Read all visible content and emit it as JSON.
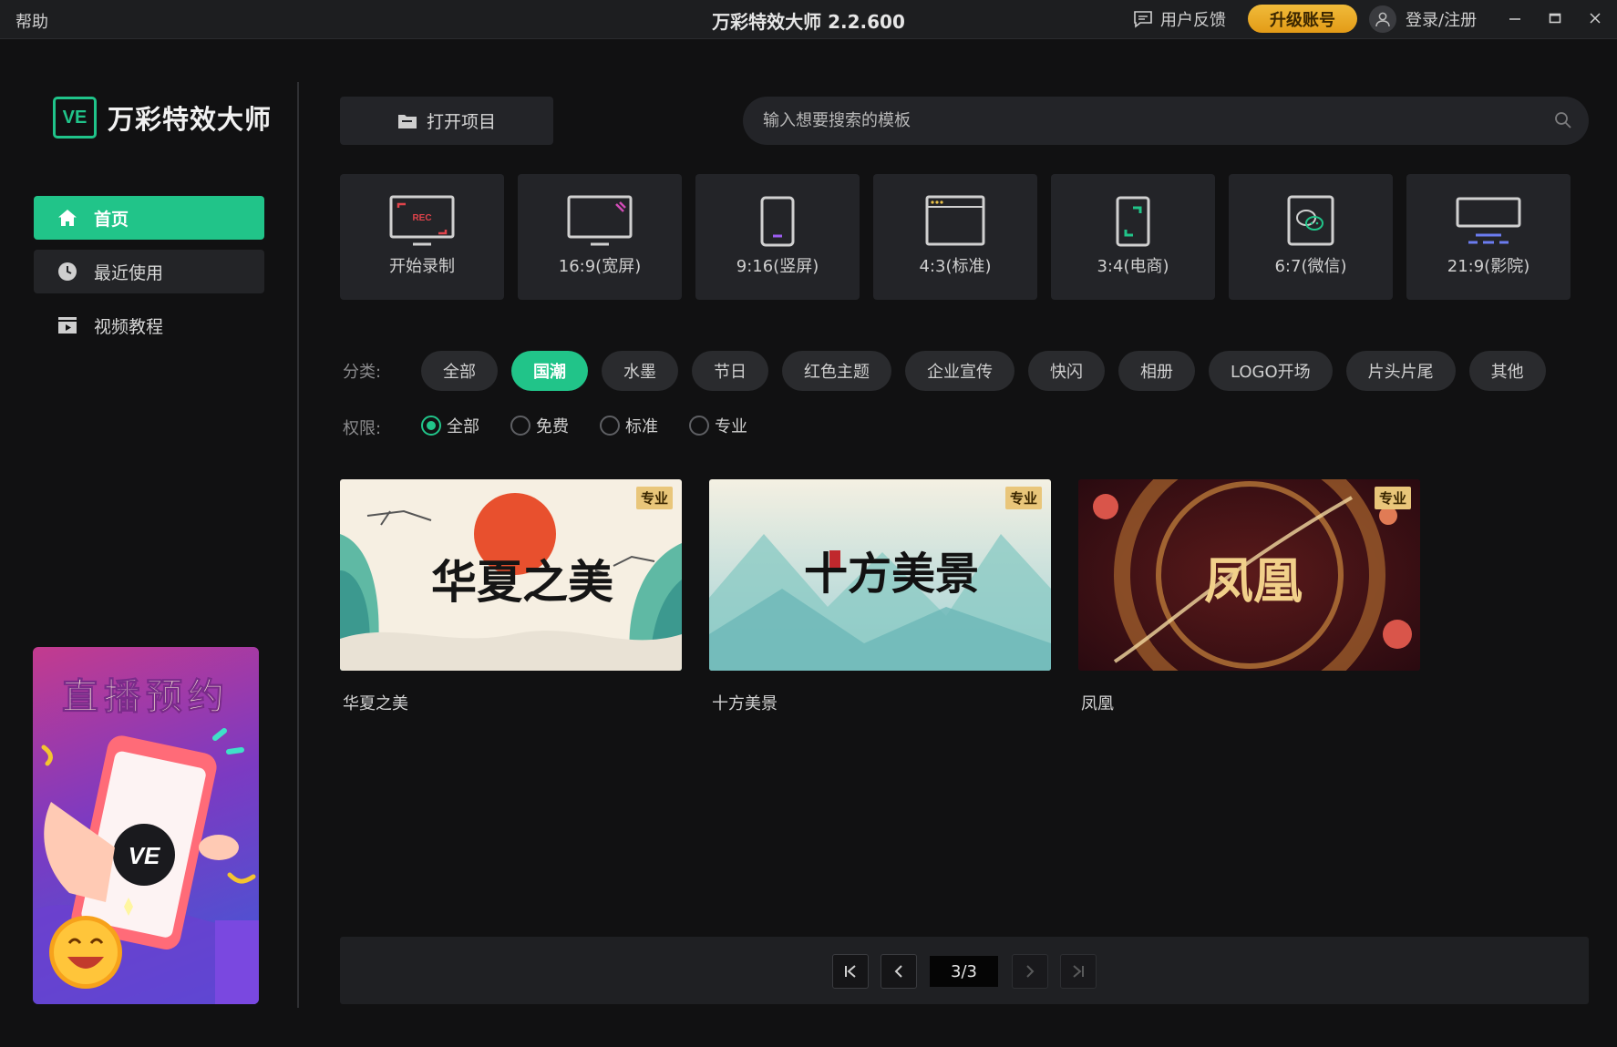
{
  "titlebar": {
    "help": "帮助",
    "title": "万彩特效大师 2.2.600",
    "feedback": "用户反馈",
    "upgrade": "升级账号",
    "login": "登录/注册"
  },
  "sidebar": {
    "logo_mark": "VE",
    "logo_text": "万彩特效大师",
    "items": [
      {
        "label": "首页",
        "icon": "home-icon"
      },
      {
        "label": "最近使用",
        "icon": "clock-icon"
      },
      {
        "label": "视频教程",
        "icon": "film-icon"
      }
    ],
    "promo": {
      "title": "直播预约",
      "phone_mark": "VE"
    }
  },
  "main": {
    "open_project": "打开项目",
    "search_placeholder": "输入想要搜索的模板",
    "ratios": [
      {
        "label": "开始录制",
        "icon": "rec-screen-icon",
        "badge": "REC"
      },
      {
        "label": "16:9(宽屏)",
        "icon": "widescreen-icon"
      },
      {
        "label": "9:16(竖屏)",
        "icon": "portrait-icon"
      },
      {
        "label": "4:3(标准)",
        "icon": "standard-icon"
      },
      {
        "label": "3:4(电商)",
        "icon": "ecommerce-icon"
      },
      {
        "label": "6:7(微信)",
        "icon": "wechat-icon"
      },
      {
        "label": "21:9(影院)",
        "icon": "cinema-icon"
      }
    ],
    "category_label": "分类:",
    "categories": [
      "全部",
      "国潮",
      "水墨",
      "节日",
      "红色主题",
      "企业宣传",
      "快闪",
      "相册",
      "LOGO开场",
      "片头片尾",
      "其他"
    ],
    "active_category": "国潮",
    "permission_label": "权限:",
    "permissions": [
      "全部",
      "免费",
      "标准",
      "专业"
    ],
    "active_permission": "全部",
    "templates": [
      {
        "name": "华夏之美",
        "badge": "专业",
        "art_text": "华夏之美"
      },
      {
        "name": "十方美景",
        "badge": "专业",
        "art_text": "十方美景"
      },
      {
        "name": "凤凰",
        "badge": "专业",
        "art_text": "凤凰"
      }
    ],
    "pager": {
      "current": "3/3"
    }
  },
  "colors": {
    "accent": "#21c489",
    "upgrade": "#e9a62a",
    "background": "#111112"
  }
}
